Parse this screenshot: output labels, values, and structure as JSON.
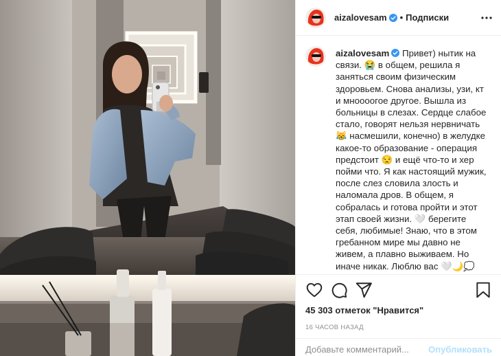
{
  "post": {
    "username": "aizalovesam",
    "dot": "•",
    "follow_label": "Подписки",
    "caption_username": "aizalovesam",
    "caption_text": " Привет) нытик на связи. 😭 в общем, решила я заняться своим физическим здоровьем. Снова анализы, узи, кт и мноооогое другое. Вышла из больницы в слезах. Сердце слабое стало, говорят нельзя нервничать 😹 насмешили, конечно) в желудке какое-то образование - операция предстоит 😒 и ещё что-то и хер пойми что. Я как настоящий мужик, после слез словила злость и наломала дров. В общем, я собралась и готова пройти и этот этап своей жизни. 🤍 берегите себя, любимые! Знаю, что в этом гребанном мире мы давно не живем, а плавно выживаем. Но иначе никак. Люблю вас 🤍🌙💭",
    "likes": "45 303 отметок \"Нравится\"",
    "time_ago": "16 ЧАСОВ НАЗАД",
    "comment_placeholder": "Добавьте комментарий...",
    "publish_label": "Опубликовать"
  },
  "icons": {
    "like": "heart-icon",
    "comment": "comment-icon",
    "share": "share-icon",
    "save": "bookmark-icon",
    "more": "more-options-icon",
    "verified": "verified-badge-icon"
  },
  "colors": {
    "link_inactive": "#b2dffc",
    "verified": "#3897f0",
    "avatar_hair": "#e8321e"
  }
}
